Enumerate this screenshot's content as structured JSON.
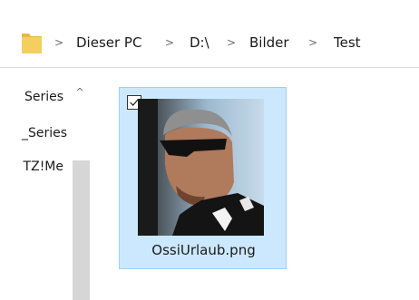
{
  "breadcrumb": {
    "items": [
      "Dieser PC",
      "D:\\",
      "Bilder",
      "Test"
    ],
    "separator": ">"
  },
  "nav_pane": {
    "items": [
      "Series",
      "_Series",
      "TZ!Me"
    ],
    "scroll_up_glyph": "^"
  },
  "file": {
    "name": "OssiUrlaub.png",
    "selected": true,
    "checked": true
  },
  "colors": {
    "selection_fill": "#cce8ff",
    "selection_border": "#99d1ff",
    "folder_yellow": "#f4cf5e"
  },
  "icons": {
    "location": "folder-icon",
    "nav_scroll": "chevron-up-icon",
    "selection": "checkbox-checked-icon"
  }
}
